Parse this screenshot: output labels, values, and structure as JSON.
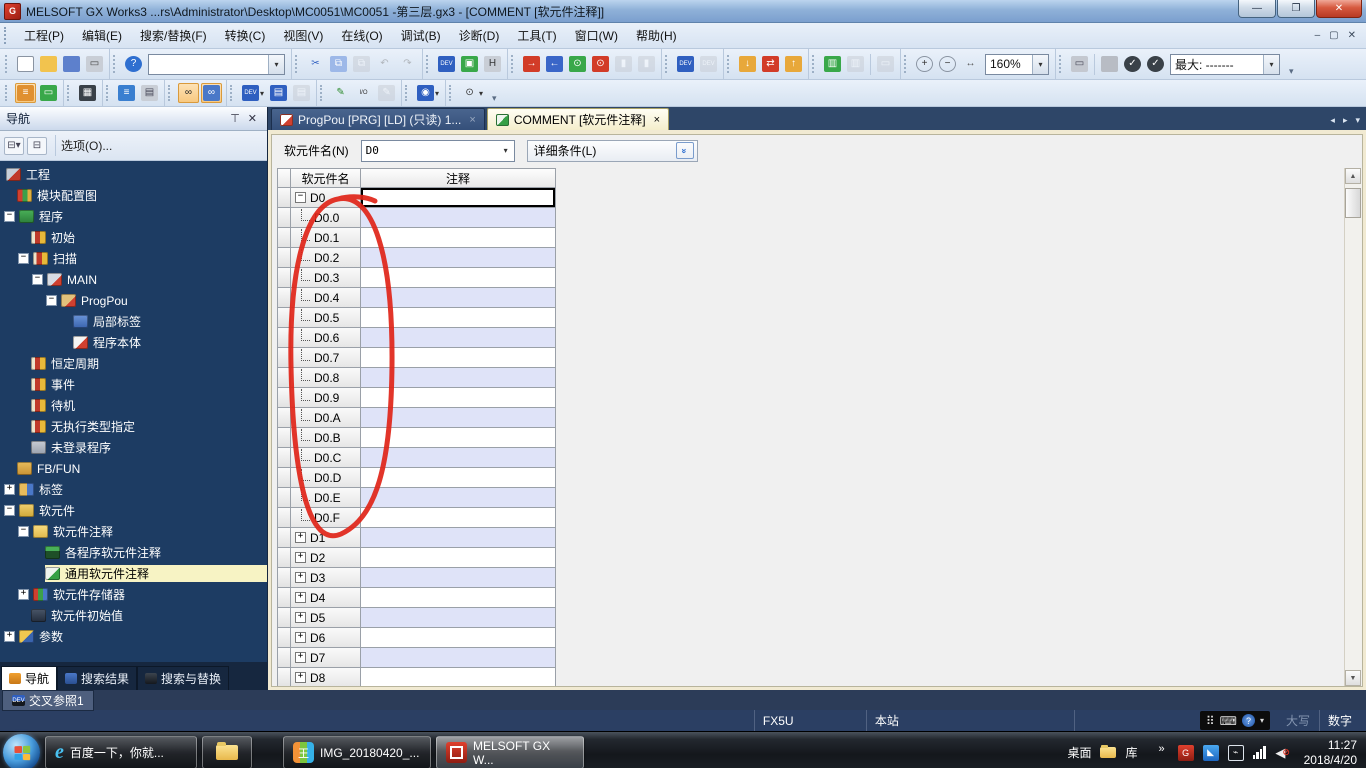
{
  "window": {
    "title": "MELSOFT GX Works3 ...rs\\Administrator\\Desktop\\MC0051\\MC0051 -第三层.gx3 - [COMMENT [软元件注释]]",
    "buttons": {
      "minimize": "—",
      "restore": "❐",
      "close": "✕"
    }
  },
  "menu": {
    "items": [
      "工程(P)",
      "编辑(E)",
      "搜索/替换(F)",
      "转换(C)",
      "视图(V)",
      "在线(O)",
      "调试(B)",
      "诊断(D)",
      "工具(T)",
      "窗口(W)",
      "帮助(H)"
    ]
  },
  "toolbar_main": {
    "zoom_value": "160%",
    "max_value": "最大: -------",
    "groups": [
      [
        {
          "n": "new-file-icon",
          "c": "#ffffff",
          "g": "",
          "fr": 1
        },
        {
          "n": "open-file-icon",
          "c": "#f2c34e",
          "g": ""
        },
        {
          "n": "save-icon",
          "c": "#5d80cc",
          "g": ""
        },
        {
          "n": "print-icon",
          "c": "#c9ced6",
          "g": "▭",
          "fg": "#444"
        }
      ],
      [
        {
          "n": "help-icon",
          "c": "#2f6fd0",
          "g": "?",
          "round": 1
        },
        {
          "t": "combo",
          "n": "quick-find-combobox",
          "v": ""
        }
      ],
      [
        {
          "n": "cut-icon",
          "g": "✂",
          "fg": "#2f5fc0"
        },
        {
          "n": "copy-icon",
          "c": "#9db8e8",
          "g": "⧉"
        },
        {
          "n": "paste-icon",
          "c": "#c4c8d0",
          "g": "⧉",
          "dis": 1
        },
        {
          "n": "undo-icon",
          "g": "↶",
          "fg": "#777",
          "dis": 1
        },
        {
          "n": "redo-icon",
          "g": "↷",
          "fg": "#777",
          "dis": 1
        }
      ],
      [
        {
          "n": "device-find-icon",
          "c": "#2f5fc0",
          "g": "DEV",
          "small": 1
        },
        {
          "n": "write-monitor-icon",
          "c": "#39a84a",
          "g": "▣"
        },
        {
          "n": "hex-display-icon",
          "c": "#c9ced6",
          "g": "H",
          "fg": "#333"
        }
      ],
      [
        {
          "n": "write-to-plc-icon",
          "c": "#d23c28",
          "g": "→"
        },
        {
          "n": "read-from-plc-icon",
          "c": "#3a66c8",
          "g": "←"
        },
        {
          "n": "monitor-start-icon",
          "c": "#39a84a",
          "g": "⊙"
        },
        {
          "n": "monitor-stop-icon",
          "c": "#d23c28",
          "g": "⊙"
        },
        {
          "n": "monitor-pause-icon",
          "c": "#c4c8d0",
          "g": "▮",
          "dis": 1
        },
        {
          "n": "monitor-step-icon",
          "c": "#c4c8d0",
          "g": "▮",
          "dis": 1
        }
      ],
      [
        {
          "n": "device-watch-icon",
          "c": "#2f5fc0",
          "g": "DEV",
          "small": 1
        },
        {
          "n": "device-watch2-icon",
          "c": "#c4c8d0",
          "g": "DEV",
          "small": 1,
          "dis": 1
        }
      ],
      [
        {
          "n": "online-change-icon",
          "c": "#e8a83a",
          "g": "↓"
        },
        {
          "n": "verify-icon",
          "c": "#d23c28",
          "g": "⇄"
        },
        {
          "n": "online-read-icon",
          "c": "#e8a83a",
          "g": "↑"
        }
      ],
      [
        {
          "n": "connection-setup-icon",
          "c": "#39a84a",
          "g": "▥"
        },
        {
          "n": "connection-test-icon",
          "c": "#c4c8d0",
          "g": "▥",
          "dis": 1
        },
        {
          "t": "sep"
        },
        {
          "n": "simulator-icon",
          "c": "#c4c8d0",
          "g": "▭",
          "dis": 1
        }
      ],
      [
        {
          "n": "zoom-in-icon",
          "g": "+",
          "fg": "#333",
          "fr": 1,
          "round": 1
        },
        {
          "n": "zoom-out-icon",
          "g": "−",
          "fg": "#333",
          "fr": 1,
          "round": 1
        },
        {
          "n": "fit-width-icon",
          "g": "↔",
          "fg": "#555"
        },
        {
          "t": "combo",
          "n": "zoom-combobox",
          "v": "160%"
        }
      ],
      [
        {
          "n": "screen-color-icon",
          "c": "#c4c8d0",
          "g": "▭",
          "fg": "#445"
        },
        {
          "t": "sep"
        },
        {
          "n": "comment-disabled-icon",
          "c": "#b8bcc4",
          "g": ""
        },
        {
          "n": "check-program-icon",
          "c": "#3a4148",
          "g": "✓",
          "round": 1
        },
        {
          "n": "check-param-icon",
          "c": "#3a4148",
          "g": "✓",
          "round": 1
        },
        {
          "t": "combo",
          "n": "max-points-combobox",
          "v": "最大: -------"
        }
      ]
    ]
  },
  "toolbar_view": {
    "groups": [
      [
        {
          "n": "navigation-window-icon",
          "c": "#e09030",
          "g": "≡",
          "hl": 1
        },
        {
          "n": "output-window-icon",
          "c": "#39a84a",
          "g": "▭"
        }
      ],
      [
        {
          "n": "module-list-icon",
          "c": "#3a4148",
          "g": "▦"
        }
      ],
      [
        {
          "n": "element-selection-icon",
          "c": "#3a7fd0",
          "g": "≡"
        },
        {
          "n": "watch-window-icon",
          "c": "#c9ced6",
          "g": "▤",
          "fg": "#445"
        }
      ],
      [
        {
          "n": "find-icon",
          "g": "∞",
          "fg": "#222",
          "hl": 1
        },
        {
          "n": "find-replace-window-icon",
          "c": "#4a78c8",
          "g": "∞",
          "hl": 1
        }
      ],
      [
        {
          "n": "device-find-dd-icon",
          "c": "#2f5fc0",
          "g": "DEV",
          "small": 1,
          "dd": 1
        },
        {
          "n": "device-list-icon",
          "c": "#2f5fc0",
          "g": "▤"
        },
        {
          "n": "device-list2-icon",
          "c": "#c4c8d0",
          "g": "▤",
          "dis": 1
        }
      ],
      [
        {
          "n": "edit-mode-icon",
          "g": "✎",
          "fg": "#2a8a2a"
        },
        {
          "n": "io-check-icon",
          "g": "I/O",
          "fg": "#333",
          "small": 1
        },
        {
          "n": "stamp-icon",
          "c": "#c4c8d0",
          "g": "✎",
          "dis": 1
        }
      ],
      [
        {
          "n": "device-display-icon",
          "c": "#2f5fc0",
          "g": "◉",
          "dd": 1
        }
      ],
      [
        {
          "n": "device-zoom-icon",
          "g": "⊙",
          "fg": "#333",
          "dd": 1
        }
      ]
    ]
  },
  "nav": {
    "title": "导航",
    "pin_icon": "⊤",
    "close_icon": "✕",
    "tools": {
      "options_label": "选项(O)..."
    },
    "tree": [
      {
        "label": "工程",
        "level": 0,
        "icon": "project"
      },
      {
        "label": "模块配置图",
        "level": 1,
        "icon": "module-config"
      },
      {
        "label": "程序",
        "level": 1,
        "expand": "minus",
        "icon": "program"
      },
      {
        "label": "初始",
        "level": 2,
        "icon": "exec"
      },
      {
        "label": "扫描",
        "level": 2,
        "expand": "minus",
        "icon": "exec"
      },
      {
        "label": "MAIN",
        "level": 3,
        "expand": "minus",
        "icon": "main"
      },
      {
        "label": "ProgPou",
        "level": 4,
        "expand": "minus",
        "icon": "progpou"
      },
      {
        "label": "局部标签",
        "level": 5,
        "icon": "local-label"
      },
      {
        "label": "程序本体",
        "level": 5,
        "icon": "program-body"
      },
      {
        "label": "恒定周期",
        "level": 2,
        "icon": "exec"
      },
      {
        "label": "事件",
        "level": 2,
        "icon": "exec"
      },
      {
        "label": "待机",
        "level": 2,
        "icon": "exec"
      },
      {
        "label": "无执行类型指定",
        "level": 2,
        "icon": "exec"
      },
      {
        "label": "未登录程序",
        "level": 2,
        "icon": "unreg"
      },
      {
        "label": "FB/FUN",
        "level": 1,
        "icon": "fbfun"
      },
      {
        "label": "标签",
        "level": 1,
        "expand": "plus",
        "icon": "label"
      },
      {
        "label": "软元件",
        "level": 1,
        "expand": "minus",
        "icon": "device"
      },
      {
        "label": "软元件注释",
        "level": 2,
        "expand": "minus",
        "icon": "device-comment"
      },
      {
        "label": "各程序软元件注释",
        "level": 3,
        "icon": "per-comment"
      },
      {
        "label": "通用软元件注释",
        "level": 3,
        "icon": "common-comment",
        "selected": true
      },
      {
        "label": "软元件存储器",
        "level": 2,
        "expand": "plus",
        "icon": "device-memory"
      },
      {
        "label": "软元件初始值",
        "level": 2,
        "icon": "device-initial"
      },
      {
        "label": "参数",
        "level": 1,
        "expand": "plus",
        "icon": "parameter"
      }
    ],
    "bottom_tabs": [
      {
        "label": "导航",
        "icon": "nav",
        "active": true
      },
      {
        "label": "搜索结果",
        "icon": "result",
        "active": false
      },
      {
        "label": "搜索与替换",
        "icon": "find",
        "active": false
      }
    ]
  },
  "doc": {
    "tabs": [
      {
        "label": "ProgPou [PRG] [LD] (只读) 1...",
        "icon": "ladder",
        "active": false,
        "close": "×"
      },
      {
        "label": "COMMENT [软元件注释]",
        "icon": "comment",
        "active": true,
        "close": "×"
      }
    ],
    "tab_nav_icons": [
      "◂",
      "▸",
      "▾"
    ],
    "filter": {
      "device_label": "软元件名(N)",
      "device_value": "D0",
      "detail_label": "详细条件(L)",
      "chevron": "»"
    },
    "table": {
      "headers": [
        "软元件名",
        "注释"
      ],
      "rows": [
        {
          "device": "D0",
          "expand": "minus",
          "selected": true,
          "shade": false,
          "comment": ""
        },
        {
          "device": "D0.0",
          "bit": true,
          "shade": true,
          "comment": ""
        },
        {
          "device": "D0.1",
          "bit": true,
          "shade": false,
          "comment": ""
        },
        {
          "device": "D0.2",
          "bit": true,
          "shade": true,
          "comment": ""
        },
        {
          "device": "D0.3",
          "bit": true,
          "shade": false,
          "comment": ""
        },
        {
          "device": "D0.4",
          "bit": true,
          "shade": true,
          "comment": ""
        },
        {
          "device": "D0.5",
          "bit": true,
          "shade": false,
          "comment": ""
        },
        {
          "device": "D0.6",
          "bit": true,
          "shade": true,
          "comment": ""
        },
        {
          "device": "D0.7",
          "bit": true,
          "shade": false,
          "comment": ""
        },
        {
          "device": "D0.8",
          "bit": true,
          "shade": true,
          "comment": ""
        },
        {
          "device": "D0.9",
          "bit": true,
          "shade": false,
          "comment": ""
        },
        {
          "device": "D0.A",
          "bit": true,
          "shade": true,
          "comment": ""
        },
        {
          "device": "D0.B",
          "bit": true,
          "shade": false,
          "comment": ""
        },
        {
          "device": "D0.C",
          "bit": true,
          "shade": true,
          "comment": ""
        },
        {
          "device": "D0.D",
          "bit": true,
          "shade": false,
          "comment": ""
        },
        {
          "device": "D0.E",
          "bit": true,
          "shade": true,
          "comment": ""
        },
        {
          "device": "D0.F",
          "bit": true,
          "shade": false,
          "comment": ""
        },
        {
          "device": "D1",
          "expand": "plus",
          "shade": true,
          "comment": ""
        },
        {
          "device": "D2",
          "expand": "plus",
          "shade": false,
          "comment": ""
        },
        {
          "device": "D3",
          "expand": "plus",
          "shade": true,
          "comment": ""
        },
        {
          "device": "D4",
          "expand": "plus",
          "shade": false,
          "comment": ""
        },
        {
          "device": "D5",
          "expand": "plus",
          "shade": true,
          "comment": ""
        },
        {
          "device": "D6",
          "expand": "plus",
          "shade": false,
          "comment": ""
        },
        {
          "device": "D7",
          "expand": "plus",
          "shade": true,
          "comment": ""
        },
        {
          "device": "D8",
          "expand": "plus",
          "shade": false,
          "comment": ""
        }
      ]
    },
    "annotation_color": "#e02418"
  },
  "crossref": {
    "label": "交叉参照1"
  },
  "statusbar": {
    "plc_type": "FX5U",
    "station": "本站",
    "caps_label": "大写",
    "num_label": "数字",
    "lang_icons": [
      "⠿",
      "⌨",
      "?",
      "▾"
    ]
  },
  "taskbar": {
    "buttons": [
      {
        "name": "ie-baidu",
        "label": "百度一下，你就...",
        "icon": "ie"
      },
      {
        "name": "explorer",
        "label": "",
        "icon": "folder"
      },
      {
        "name": "image-viewer",
        "label": "IMG_20180420_...",
        "icon": "img"
      },
      {
        "name": "melsoft",
        "label": "MELSOFT GX W...",
        "icon": "melsoft",
        "active": true
      }
    ],
    "desktop_label": "桌面",
    "library_label": "库",
    "overflow_chevron": "»",
    "clock": {
      "time": "11:27",
      "date": "2018/4/20"
    }
  }
}
